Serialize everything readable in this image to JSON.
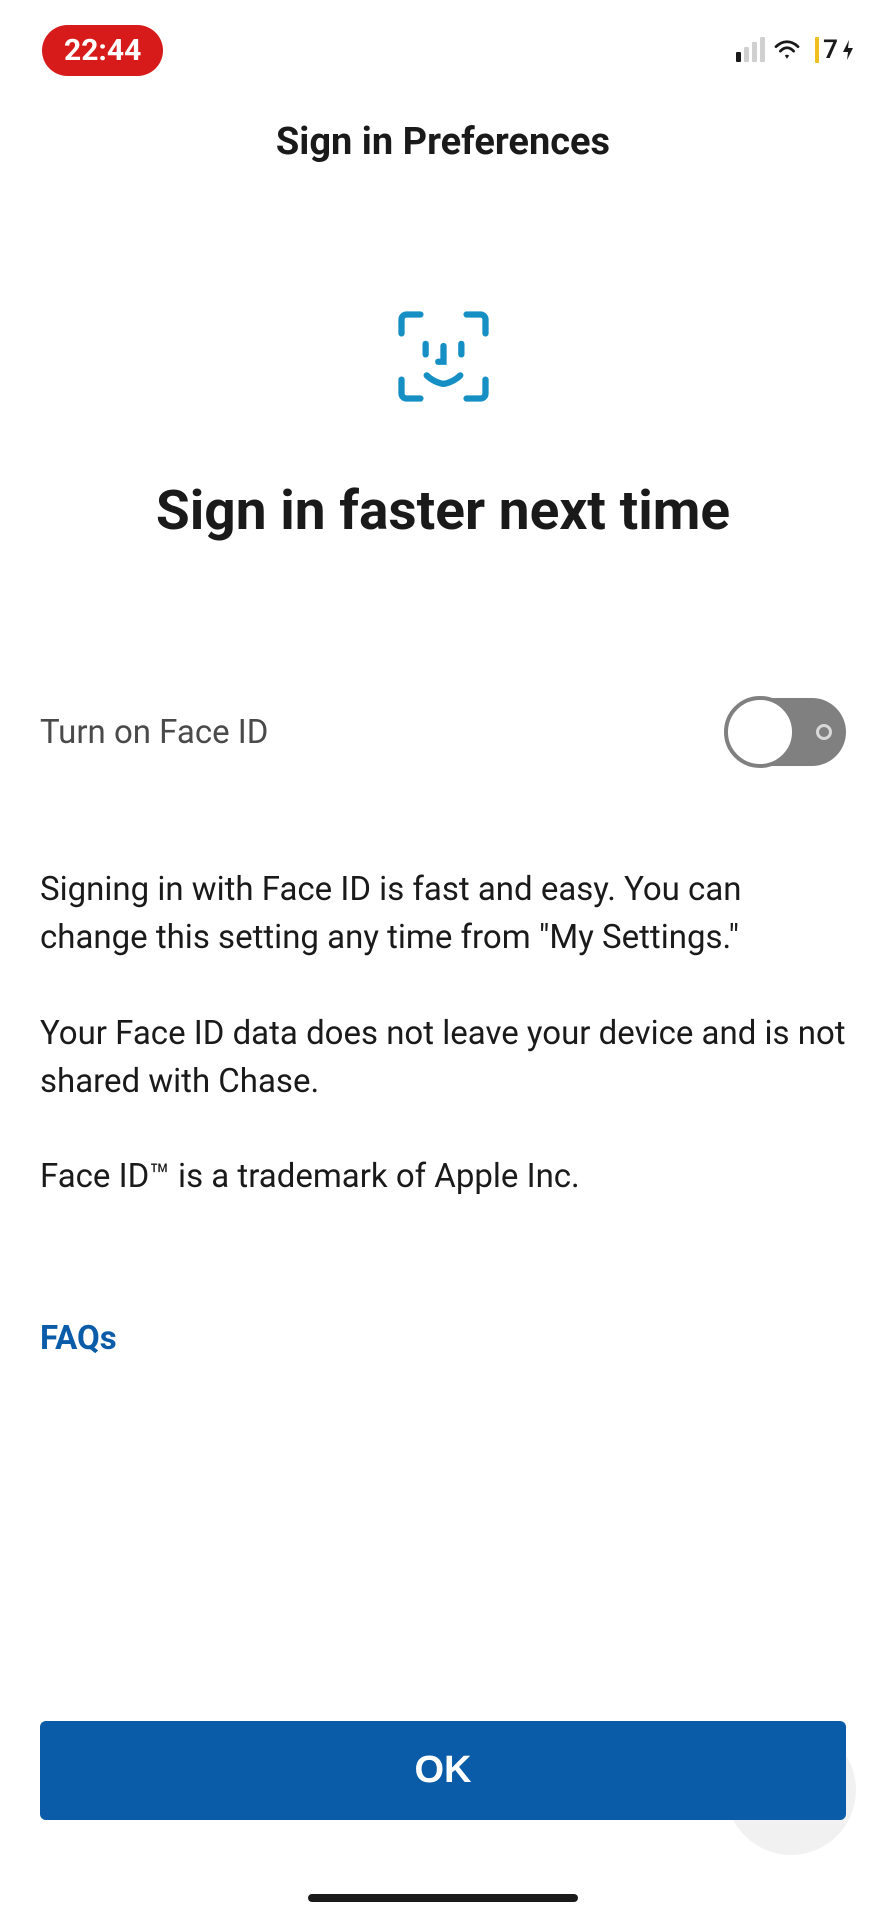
{
  "statusBar": {
    "time": "22:44",
    "batteryText": "7"
  },
  "header": {
    "title": "Sign in Preferences"
  },
  "main": {
    "heading": "Sign in faster next time",
    "toggleLabel": "Turn on Face ID",
    "description1": "Signing in with Face ID is fast and easy. You can change this setting any time from \"My Settings.\"",
    "description2": "Your Face ID data does not leave your device and is not shared with Chase.",
    "description3": "Face ID™ is a trademark of Apple Inc.",
    "faqsLabel": "FAQs"
  },
  "footer": {
    "okButton": "OK"
  },
  "colors": {
    "accent": "#0a5ba8",
    "timePill": "#d71a1a",
    "batteryBar": "#f0c020"
  }
}
